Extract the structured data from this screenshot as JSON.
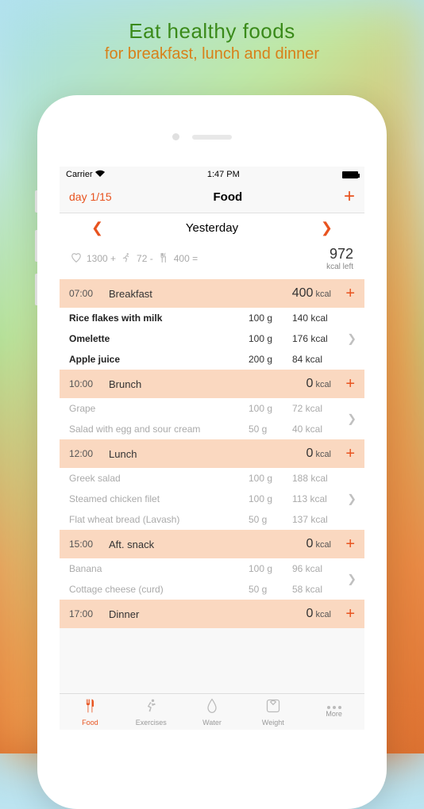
{
  "promo": {
    "title": "Eat healthy foods",
    "subtitle": "for breakfast, lunch and dinner"
  },
  "status_bar": {
    "carrier": "Carrier",
    "time": "1:47 PM"
  },
  "nav": {
    "day_counter": "day 1/15",
    "title": "Food"
  },
  "date": {
    "label": "Yesterday"
  },
  "summary": {
    "base": "1300 +",
    "exercise": "72 -",
    "food": "400 =",
    "remaining": "972",
    "remaining_label": "kcal left"
  },
  "kcal_unit": "kcal",
  "meals": {
    "breakfast": {
      "time": "07:00",
      "name": "Breakfast",
      "kcal": "400",
      "items": [
        {
          "name": "Rice flakes with milk",
          "amt": "100 g",
          "cal": "140 kcal"
        },
        {
          "name": "Omelette",
          "amt": "100 g",
          "cal": "176 kcal"
        },
        {
          "name": "Apple juice",
          "amt": "200 g",
          "cal": "84 kcal"
        }
      ]
    },
    "brunch": {
      "time": "10:00",
      "name": "Brunch",
      "kcal": "0",
      "items": [
        {
          "name": "Grape",
          "amt": "100 g",
          "cal": "72 kcal"
        },
        {
          "name": "Salad with egg and sour cream",
          "amt": "50 g",
          "cal": "40 kcal"
        }
      ]
    },
    "lunch": {
      "time": "12:00",
      "name": "Lunch",
      "kcal": "0",
      "items": [
        {
          "name": "Greek salad",
          "amt": "100 g",
          "cal": "188 kcal"
        },
        {
          "name": "Steamed chicken filet",
          "amt": "100 g",
          "cal": "113 kcal"
        },
        {
          "name": "Flat wheat bread (Lavash)",
          "amt": "50 g",
          "cal": "137 kcal"
        }
      ]
    },
    "snack": {
      "time": "15:00",
      "name": "Aft. snack",
      "kcal": "0",
      "items": [
        {
          "name": "Banana",
          "amt": "100 g",
          "cal": "96 kcal"
        },
        {
          "name": "Cottage cheese (curd)",
          "amt": "50 g",
          "cal": "58 kcal"
        }
      ]
    },
    "dinner": {
      "time": "17:00",
      "name": "Dinner",
      "kcal": "0"
    }
  },
  "tabs": {
    "food": "Food",
    "exercises": "Exercises",
    "water": "Water",
    "weight": "Weight",
    "more": "More"
  }
}
